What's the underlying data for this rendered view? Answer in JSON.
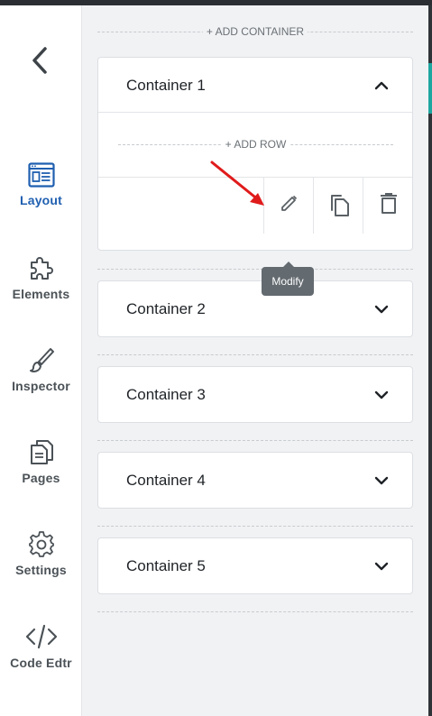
{
  "sidebar": {
    "back_icon": "chevron-left-icon",
    "items": [
      {
        "label": "Layout",
        "icon": "layout-icon",
        "active": true
      },
      {
        "label": "Elements",
        "icon": "puzzle-icon",
        "active": false
      },
      {
        "label": "Inspector",
        "icon": "brush-icon",
        "active": false
      },
      {
        "label": "Pages",
        "icon": "pages-icon",
        "active": false
      },
      {
        "label": "Settings",
        "icon": "gear-icon",
        "active": false
      },
      {
        "label": "Code Edtr",
        "icon": "code-icon",
        "active": false
      }
    ]
  },
  "panel": {
    "add_container_label": "+ ADD CONTAINER",
    "add_row_label": "+ ADD ROW",
    "containers": [
      {
        "title": "Container 1",
        "expanded": true
      },
      {
        "title": "Container 2",
        "expanded": false
      },
      {
        "title": "Container 3",
        "expanded": false
      },
      {
        "title": "Container 4",
        "expanded": false
      },
      {
        "title": "Container 5",
        "expanded": false
      }
    ],
    "row_actions": [
      {
        "name": "modify",
        "icon": "pencil-icon"
      },
      {
        "name": "duplicate",
        "icon": "copy-icon"
      },
      {
        "name": "delete",
        "icon": "trash-icon"
      }
    ],
    "tooltip": "Modify"
  },
  "colors": {
    "accent": "#1f5fb0",
    "annotation_arrow": "#e01b1b",
    "tooltip_bg": "#636a70",
    "panel_bg": "#f1f2f4"
  }
}
